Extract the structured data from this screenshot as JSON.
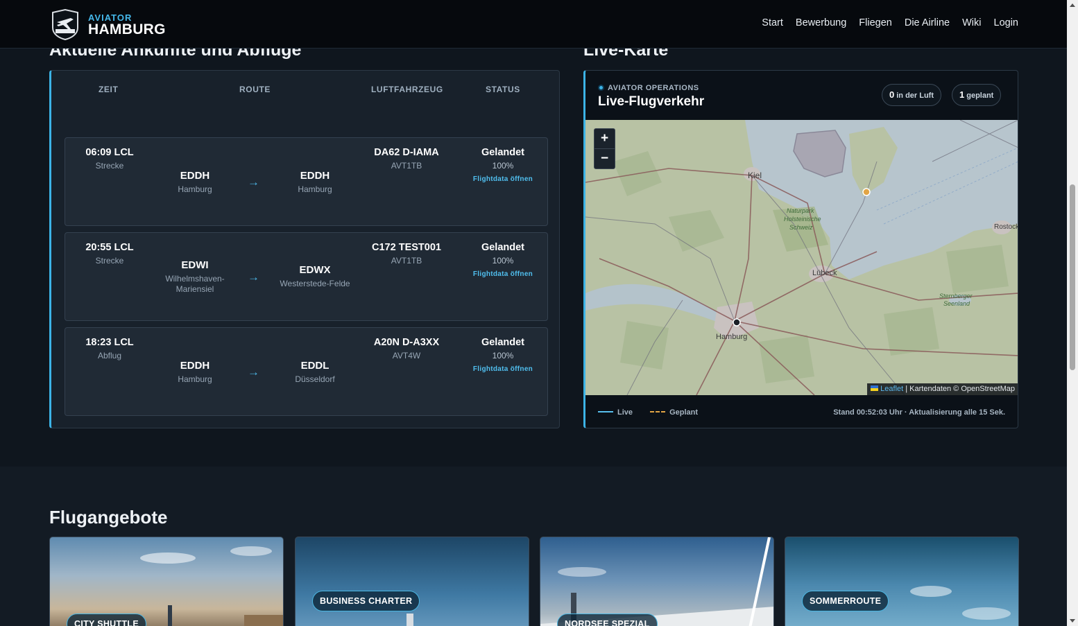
{
  "header": {
    "brand_top": "AVIATOR",
    "brand_main": "HAMBURG",
    "nav": [
      "Start",
      "Bewerbung",
      "Fliegen",
      "Die Airline",
      "Wiki",
      "Login"
    ]
  },
  "flights_section": {
    "title": "Aktuelle Ankünfte und Abflüge",
    "columns": {
      "time": "ZEIT",
      "route": "ROUTE",
      "aircraft": "LUFTFAHRZEUG",
      "status": "STATUS"
    },
    "rows": [
      {
        "time": "06:09 LCL",
        "type": "Strecke",
        "from_code": "EDDH",
        "from_city": "Hamburg",
        "arrow": "→",
        "to_code": "EDDH",
        "to_city": "Hamburg",
        "aircraft": "DA62 D-IAMA",
        "callsign": "AVT1TB",
        "status": "Gelandet",
        "progress": "100%",
        "link": "Flightdata öffnen"
      },
      {
        "time": "20:55 LCL",
        "type": "Strecke",
        "from_code": "EDWI",
        "from_city": "Wilhelmshaven-Mariensiel",
        "arrow": "→",
        "to_code": "EDWX",
        "to_city": "Westerstede-Felde",
        "aircraft": "C172 TEST001",
        "callsign": "AVT1TB",
        "status": "Gelandet",
        "progress": "100%",
        "link": "Flightdata öffnen"
      },
      {
        "time": "18:23 LCL",
        "type": "Abflug",
        "from_code": "EDDH",
        "from_city": "Hamburg",
        "arrow": "→",
        "to_code": "EDDL",
        "to_city": "Düsseldorf",
        "aircraft": "A20N D-A3XX",
        "callsign": "AVT4W",
        "status": "Gelandet",
        "progress": "100%",
        "link": "Flightdata öffnen"
      }
    ]
  },
  "map_section": {
    "title": "Live-Karte",
    "ops_label": "AVIATOR OPERATIONS",
    "panel_title": "Live-Flugverkehr",
    "airborne_count": "0",
    "airborne_label": "in der Luft",
    "planned_count": "1",
    "planned_label": "geplant",
    "zoom_in": "+",
    "zoom_out": "−",
    "attribution_leaflet": "Leaflet",
    "attribution_rest": "| Kartendaten © OpenStreetMap",
    "legend_live": "Live",
    "legend_planned": "Geplant",
    "status_text": "Stand 00:52:03 Uhr · Aktualisierung alle 15 Sek.",
    "place_labels": [
      "Kiel",
      "Naturpark Holsteinische Schweiz",
      "Lübeck",
      "Hamburg",
      "Rostock",
      "Sternberger Seenland"
    ],
    "colors": {
      "live": "#58c0ee",
      "planned": "#e2a545",
      "accent": "#3cb3e6"
    }
  },
  "offers_section": {
    "title": "Flugangebote",
    "tags": [
      "CITY SHUTTLE",
      "BUSINESS CHARTER",
      "NORDSEE SPEZIAL",
      "SOMMERROUTE"
    ]
  }
}
